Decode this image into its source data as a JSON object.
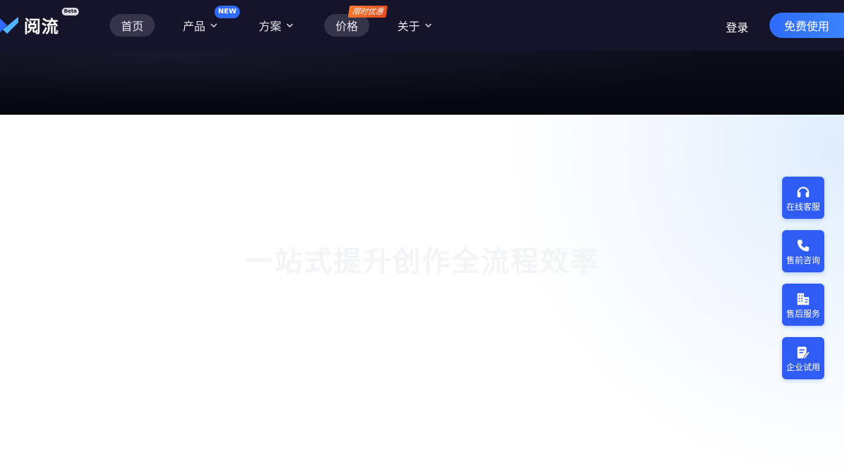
{
  "brand": {
    "name": "阅流",
    "badge": "Beta"
  },
  "nav": {
    "items": [
      {
        "label": "首页"
      },
      {
        "label": "产品",
        "badge": "NEW"
      },
      {
        "label": "方案"
      },
      {
        "label": "价格",
        "badge": "限时优惠"
      },
      {
        "label": "关于"
      }
    ],
    "login_label": "登录",
    "cta_label": "免费使用"
  },
  "hero": {
    "headline": "一站式提升创作全流程效率"
  },
  "side_panel": {
    "items": [
      {
        "label": "在线客服",
        "icon": "headset-icon"
      },
      {
        "label": "售前咨询",
        "icon": "phone-icon"
      },
      {
        "label": "售后服务",
        "icon": "building-icon"
      },
      {
        "label": "企业试用",
        "icon": "edit-document-icon"
      }
    ]
  },
  "colors": {
    "navbar_bg": "#15142a",
    "accent": "#2f6bff",
    "side_button": "#2f5cf5",
    "promo": "#ff7a2f"
  }
}
